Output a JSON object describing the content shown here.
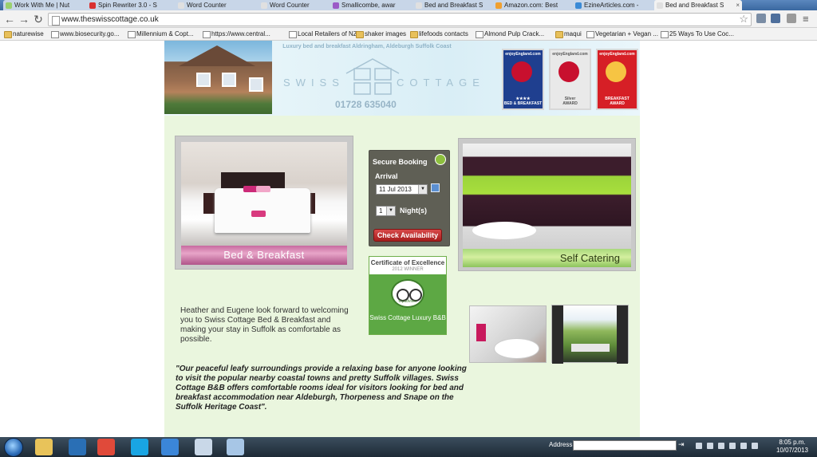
{
  "browser": {
    "tabs": [
      {
        "label": "Work With Me | Nut",
        "icon_color": "#9bd16f"
      },
      {
        "label": "Spin Rewriter 3.0 - S",
        "icon_color": "#d93030"
      },
      {
        "label": "Word Counter",
        "icon_color": "#e0e0e0"
      },
      {
        "label": "Word Counter",
        "icon_color": "#e0e0e0"
      },
      {
        "label": "Smallicombe, awar",
        "icon_color": "#9b5bc7"
      },
      {
        "label": "Bed and Breakfast S",
        "icon_color": "#e0e0e0"
      },
      {
        "label": "Amazon.com: Best",
        "icon_color": "#f0a030"
      },
      {
        "label": "EzineArticles.com -",
        "icon_color": "#3a8ad6"
      },
      {
        "label": "Bed and Breakfast S",
        "icon_color": "#e0e0e0",
        "active": true
      }
    ],
    "tab_close_glyph": "×",
    "url": "www.theswisscottage.co.uk",
    "back_glyph": "←",
    "forward_glyph": "→",
    "reload_glyph": "↻",
    "star_glyph": "☆",
    "bookmarks": [
      {
        "label": "naturewise",
        "kind": "folder"
      },
      {
        "label": "www.biosecurity.go...",
        "kind": "page"
      },
      {
        "label": "Millennium & Copt...",
        "kind": "page"
      },
      {
        "label": "https://www.central...",
        "kind": "page"
      },
      {
        "label": "Local Retailers of NZ...",
        "kind": "page"
      },
      {
        "label": "shaker images",
        "kind": "folder"
      },
      {
        "label": "lifefoods contacts",
        "kind": "folder"
      },
      {
        "label": "Almond Pulp Crack...",
        "kind": "page"
      },
      {
        "label": "maqui",
        "kind": "folder"
      },
      {
        "label": "Vegetarian + Vegan ...",
        "kind": "page"
      },
      {
        "label": "25 Ways To Use Coc...",
        "kind": "page"
      }
    ]
  },
  "site": {
    "tagline": "Luxury bed and breakfast Aldringham, Aldeburgh Suffolk Coast",
    "logo_left": "SWISS",
    "logo_right": "COTTAGE",
    "phone": "01728 635040",
    "awards": [
      {
        "top": "enjoyEngland.com",
        "bottom": "★★★★\nBED & BREAKFAST",
        "color": "#1f3f8f",
        "emblem": "#c8102e"
      },
      {
        "top": "enjoyEngland.com",
        "bottom": "Silver\nAWARD",
        "color": "#e9e9e9",
        "emblem": "#c8102e"
      },
      {
        "top": "enjoyEngland.com",
        "bottom": "BREAKFAST\nAWARD",
        "color": "#d61f26",
        "emblem": "#f6c443"
      }
    ],
    "bnb_label": "Bed & Breakfast",
    "self_catering_label": "Self Catering",
    "booking": {
      "title": "Secure Booking",
      "arrival_label": "Arrival",
      "arrival_value": "11 Jul 2013",
      "nights_value": "1",
      "nights_label": "Night(s)",
      "button": "Check Availability"
    },
    "certificate": {
      "title": "Certificate of Excellence",
      "winner": "2012 WINNER",
      "brand": "tripadvisor",
      "name": "Swiss Cottage Luxury B&B"
    },
    "welcome": "Heather and Eugene look forward to welcoming you to Swiss Cottage Bed & Breakfast and making your stay in Suffolk as comfortable as possible.",
    "quote": "\"Our peaceful leafy surroundings provide a relaxing base for anyone looking to visit the popular nearby coastal towns and pretty Suffolk villages. Swiss Cottage B&B offers comfortable rooms ideal for visitors looking for bed and breakfast accommodation near Aldeburgh, Thorpeness and Snape on the Suffolk Heritage Coast\"."
  },
  "taskbar": {
    "address_label": "Address",
    "go_glyph": "⇥",
    "time": "8:05 p.m.",
    "date": "10/07/2013",
    "apps": [
      {
        "name": "explorer",
        "color": "#e8c35a"
      },
      {
        "name": "media",
        "color": "#2a6fb5"
      },
      {
        "name": "chrome",
        "color": "#e04a3a"
      },
      {
        "name": "skype",
        "color": "#19a5e3"
      },
      {
        "name": "ie",
        "color": "#3b86d8"
      },
      {
        "name": "notepad",
        "color": "#c9d8e8"
      },
      {
        "name": "word",
        "color": "#a7c6e6"
      }
    ]
  }
}
